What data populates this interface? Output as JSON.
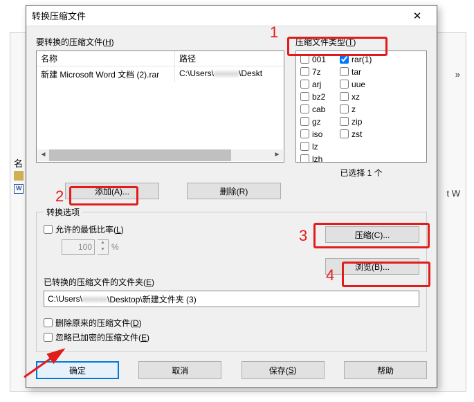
{
  "dialog": {
    "title": "转换压缩文件"
  },
  "files_section": {
    "label_pre": "要转换的压缩文件(",
    "label_key": "H",
    "label_post": ")",
    "columns": {
      "name": "名称",
      "path": "路径"
    },
    "rows": [
      {
        "name": "新建 Microsoft Word 文档 (2).rar",
        "path_pre": "C:\\Users\\",
        "path_mid": "xxxxxx",
        "path_post": "\\Deskt"
      }
    ]
  },
  "types_section": {
    "label_pre": "压缩文件类型(",
    "label_key": "T",
    "label_post": ")",
    "left_options": [
      {
        "label": "001",
        "checked": false
      },
      {
        "label": "7z",
        "checked": false
      },
      {
        "label": "arj",
        "checked": false
      },
      {
        "label": "bz2",
        "checked": false
      },
      {
        "label": "cab",
        "checked": false
      },
      {
        "label": "gz",
        "checked": false
      },
      {
        "label": "iso",
        "checked": false
      },
      {
        "label": "lz",
        "checked": false
      },
      {
        "label": "lzh",
        "checked": false
      }
    ],
    "right_options": [
      {
        "label": "rar(1)",
        "checked": true
      },
      {
        "label": "tar",
        "checked": false
      },
      {
        "label": "uue",
        "checked": false
      },
      {
        "label": "xz",
        "checked": false
      },
      {
        "label": "z",
        "checked": false
      },
      {
        "label": "zip",
        "checked": false
      },
      {
        "label": "zst",
        "checked": false
      }
    ],
    "selected_count": "已选择 1 个"
  },
  "buttons": {
    "add": "添加(A)...",
    "remove": "删除(R)",
    "compress": "压缩(C)...",
    "browse": "浏览(B)..."
  },
  "options": {
    "legend": "转换选项",
    "allow_lowest_pre": "允许的最低比率(",
    "allow_lowest_key": "L",
    "allow_lowest_post": ")",
    "ratio_value": "100",
    "percent": "%",
    "folder_label_pre": "已转换的压缩文件的文件夹(",
    "folder_label_key": "E",
    "folder_label_post": ")",
    "folder_value_pre": "C:\\Users\\",
    "folder_value_mid": "xxxxxx",
    "folder_value_post": "\\Desktop\\新建文件夹 (3)",
    "delete_orig_pre": "删除原来的压缩文件(",
    "delete_orig_key": "D",
    "delete_orig_post": ")",
    "ignore_encrypted_pre": "忽略已加密的压缩文件(",
    "ignore_encrypted_key": "E",
    "ignore_encrypted_post": ")"
  },
  "footer": {
    "ok": "确定",
    "cancel": "取消",
    "save_pre": "保存(",
    "save_key": "S",
    "save_post": ")",
    "help": "帮助"
  },
  "annotations": {
    "n1": "1",
    "n2": "2",
    "n3": "3",
    "n4": "4"
  },
  "background": {
    "col_name": "名",
    "right_quote": "»",
    "right_tw": "t W"
  }
}
